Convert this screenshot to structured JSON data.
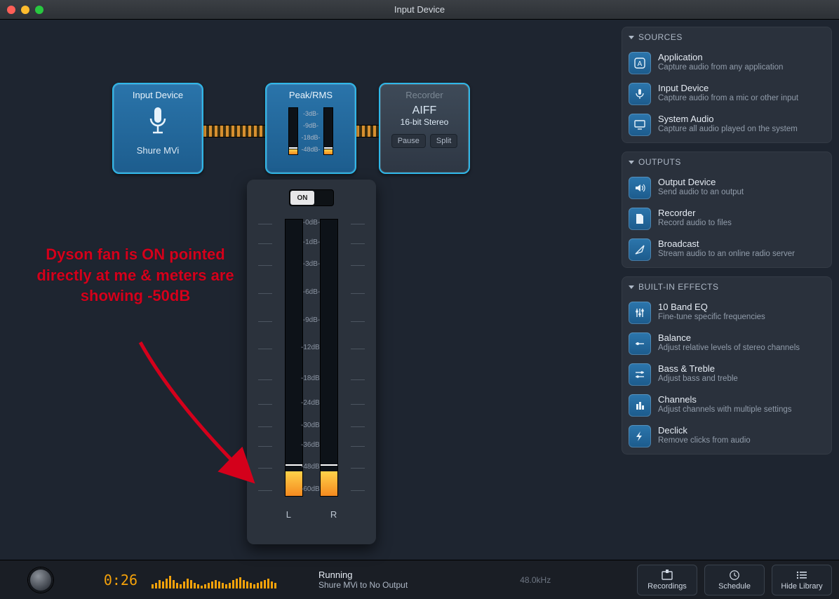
{
  "window": {
    "title": "Input Device"
  },
  "nodes": {
    "input": {
      "title": "Input Device",
      "device": "Shure MVi"
    },
    "peak": {
      "title": "Peak/RMS",
      "mini_ticks": [
        "-3dB-",
        "-9dB-",
        "-18dB-",
        "-48dB-"
      ]
    },
    "recorder": {
      "title": "Recorder",
      "format": "AIFF",
      "detail": "16-bit Stereo",
      "pause": "Pause",
      "split": "Split"
    }
  },
  "meter": {
    "toggle": "ON",
    "ticks": [
      "-0dB-",
      "-1dB-",
      "-3dB-",
      "-6dB-",
      "-9dB-",
      "-12dB-",
      "-18dB-",
      "-24dB-",
      "-30dB-",
      "-36dB-",
      "-48dB-",
      "-60dB-"
    ],
    "left_label": "L",
    "right_label": "R",
    "left_fill_pct": 9,
    "right_fill_pct": 9,
    "left_peak_pct": 11,
    "right_peak_pct": 11
  },
  "annotation": "Dyson fan is ON pointed directly at me & meters are showing -50dB",
  "library": {
    "sources": {
      "header": "SOURCES",
      "items": [
        {
          "t": "Application",
          "d": "Capture audio from any application"
        },
        {
          "t": "Input Device",
          "d": "Capture audio from a mic or other input"
        },
        {
          "t": "System Audio",
          "d": "Capture all audio played on the system"
        }
      ]
    },
    "outputs": {
      "header": "OUTPUTS",
      "items": [
        {
          "t": "Output Device",
          "d": "Send audio to an output"
        },
        {
          "t": "Recorder",
          "d": "Record audio to files"
        },
        {
          "t": "Broadcast",
          "d": "Stream audio to an online radio server"
        }
      ]
    },
    "effects": {
      "header": "BUILT-IN EFFECTS",
      "items": [
        {
          "t": "10 Band EQ",
          "d": "Fine-tune specific frequencies"
        },
        {
          "t": "Balance",
          "d": "Adjust relative levels of stereo channels"
        },
        {
          "t": "Bass & Treble",
          "d": "Adjust bass and treble"
        },
        {
          "t": "Channels",
          "d": "Adjust channels with multiple settings"
        },
        {
          "t": "Declick",
          "d": "Remove clicks from audio"
        }
      ]
    }
  },
  "footer": {
    "timer": "0:26",
    "status_a": "Running",
    "status_b": "Shure MVi to No Output",
    "sample_rate": "48.0kHz",
    "recordings": "Recordings",
    "schedule": "Schedule",
    "hide_library": "Hide Library"
  }
}
